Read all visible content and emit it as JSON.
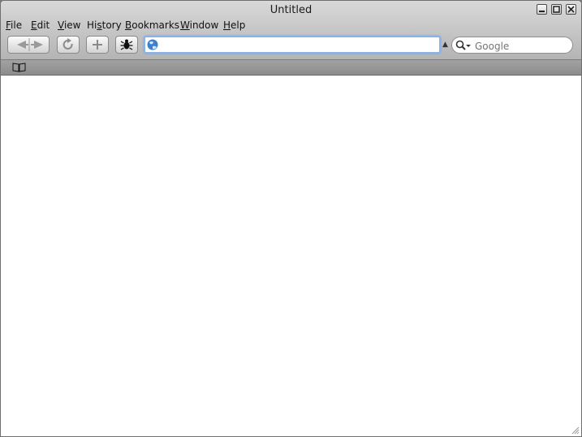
{
  "window": {
    "title": "Untitled"
  },
  "menu": [
    {
      "acc": "F",
      "rest": "ile"
    },
    {
      "acc": "E",
      "rest": "dit"
    },
    {
      "acc": "V",
      "rest": "iew"
    },
    {
      "pre": "Hi",
      "acc": "s",
      "rest": "tory"
    },
    {
      "acc": "B",
      "rest": "ookmarks"
    },
    {
      "acc": "W",
      "rest": "indow"
    },
    {
      "acc": "H",
      "rest": "elp"
    }
  ],
  "address_bar": {
    "value": "",
    "placeholder": ""
  },
  "search": {
    "placeholder": "Google"
  },
  "icons": {
    "back": "back-arrow-icon",
    "forward": "forward-arrow-icon",
    "reload": "reload-icon",
    "add": "plus-icon",
    "bug": "bug-icon",
    "globe": "globe-icon",
    "search": "search-icon",
    "bookmarks": "open-book-icon"
  }
}
